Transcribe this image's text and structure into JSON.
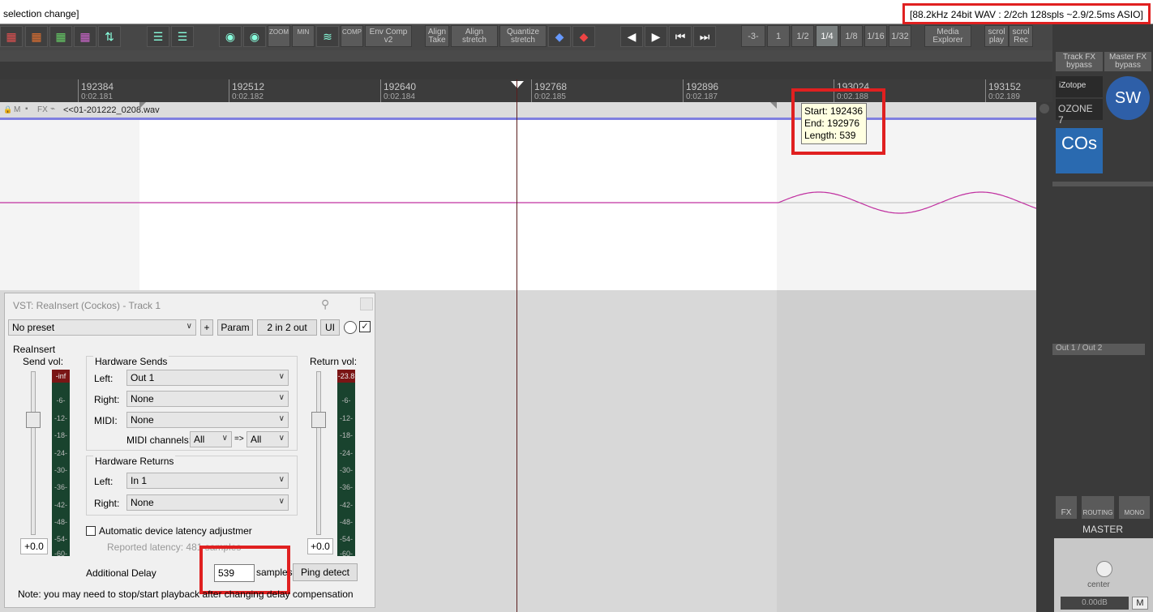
{
  "title_text": " selection change]",
  "status_text": "[88.2kHz 24bit WAV : 2/2ch 128spls ~2.9/2.5ms ASIO]",
  "toolbar": {
    "zoom": "ZOOM",
    "min": "MIN",
    "comp": "COMP",
    "env_comp": [
      "Env Comp",
      "v2"
    ],
    "align_take": [
      "Align",
      "Take"
    ],
    "align_stretch": [
      "Align",
      "stretch"
    ],
    "quantize_stretch": [
      "Quantize",
      "stretch"
    ],
    "grid": [
      "-3-",
      "1",
      "1/2",
      "1/4",
      "1/8",
      "1/16",
      "1/32"
    ],
    "grid_selected": "1/4",
    "media_explorer": [
      "Media",
      "Explorer"
    ],
    "scrol_play": [
      "scrol",
      "play"
    ],
    "scrol_rec": [
      "scrol",
      "Rec"
    ],
    "track_fx_bypass": [
      "Track FX",
      "bypass"
    ],
    "master_fx_bypass": [
      "Master FX",
      "bypass"
    ]
  },
  "ruler": [
    {
      "label": "192384",
      "time": "0:02.181"
    },
    {
      "label": "192512",
      "time": "0:02.182"
    },
    {
      "label": "192640",
      "time": "0:02.184"
    },
    {
      "label": "192768",
      "time": "0:02.185"
    },
    {
      "label": "192896",
      "time": "0:02.187"
    },
    {
      "label": "193024",
      "time": "0:02.188"
    },
    {
      "label": "193152",
      "time": "0:02.189"
    }
  ],
  "track": {
    "item_name": "<<01-201222_0208.wav",
    "header_icons": [
      "lock-icon",
      "mute-icon",
      "comment-icon",
      "fx-icon",
      "envelope-icon"
    ],
    "header_labels": [
      "M",
      "FX"
    ],
    "wave_color": "#c030a0"
  },
  "tooltip": {
    "start": "Start: 192436",
    "end": "End: 192976",
    "length": "Length: 539"
  },
  "fx": {
    "title": "VST: ReaInsert (Cockos) - Track 1",
    "preset": "No preset",
    "plus": "+",
    "param": "Param",
    "io": "2 in 2 out",
    "ui": "UI",
    "plugin_name": "ReaInsert",
    "send_vol": "Send vol:",
    "return_vol": "Return vol:",
    "send_meter_top": "-inf",
    "return_meter_top": "-23.8",
    "meter_ticks": [
      "-6-",
      "-12-",
      "-18-",
      "-24-",
      "-30-",
      "-36-",
      "-42-",
      "-48-",
      "-54-",
      "-60-"
    ],
    "send_value": "+0.0",
    "return_value": "+0.0",
    "hw_sends": "Hardware Sends",
    "left": "Left:",
    "right": "Right:",
    "midi": "MIDI:",
    "sends_left": "Out 1",
    "sends_right": "None",
    "sends_midi": "None",
    "midi_channels": "MIDI channels:",
    "midi_ch_from": "All",
    "midi_arrow": "=>",
    "midi_ch_to": "All",
    "hw_returns": "Hardware Returns",
    "returns_left": "In 1",
    "returns_right": "None",
    "auto_latency": "Automatic device latency adjustmer",
    "reported_latency": "Reported latency: 481 samples",
    "additional_delay": "Additional Delay",
    "delay_value": "539",
    "samples": "samples",
    "ping_detect": "Ping detect",
    "note": "Note: you may need to stop/start playback after changing delay compensation"
  },
  "mixer": {
    "output": "Out 1 / Out 2",
    "fx": "FX",
    "routing": "ROUTING",
    "mono": "MONO",
    "master": "MASTER",
    "pan": "center",
    "volume": "0.00dB",
    "m": "M",
    "plugins": [
      "iZotope",
      "OZONE 7",
      "SW",
      "COs"
    ]
  }
}
